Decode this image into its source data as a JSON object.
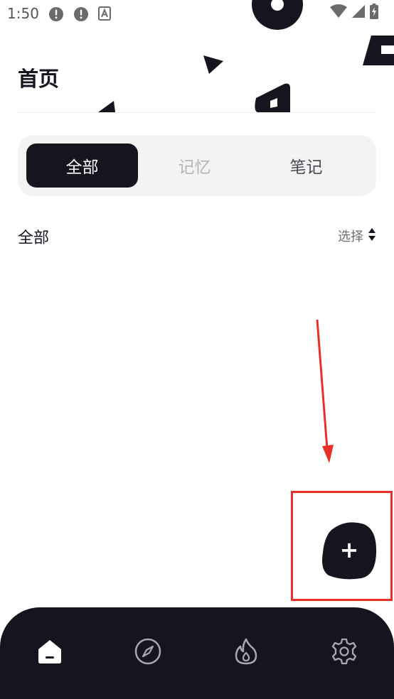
{
  "status_bar": {
    "time": "1:50",
    "icons": [
      "alert-circle-icon",
      "alert-circle-icon",
      "font-a-icon",
      "wifi-icon",
      "signal-icon",
      "battery-charging-icon"
    ]
  },
  "header": {
    "title": "首页"
  },
  "segmented_control": {
    "tabs": [
      {
        "label": "全部",
        "active": true
      },
      {
        "label": "记忆",
        "active": false
      },
      {
        "label": "笔记",
        "active": false
      }
    ]
  },
  "section": {
    "title": "全部",
    "select_label": "选择"
  },
  "fab": {
    "label": "+",
    "icon": "plus-icon"
  },
  "bottom_nav": {
    "items": [
      {
        "icon": "home-icon",
        "active": true
      },
      {
        "icon": "compass-icon",
        "active": false
      },
      {
        "icon": "flame-icon",
        "active": false
      },
      {
        "icon": "settings-gear-icon",
        "active": false
      }
    ]
  },
  "colors": {
    "dark": "#15141f",
    "accent_annotation": "#e8302a",
    "segment_bg": "#f3f3f4",
    "inactive_text": "#b5b5b8"
  }
}
